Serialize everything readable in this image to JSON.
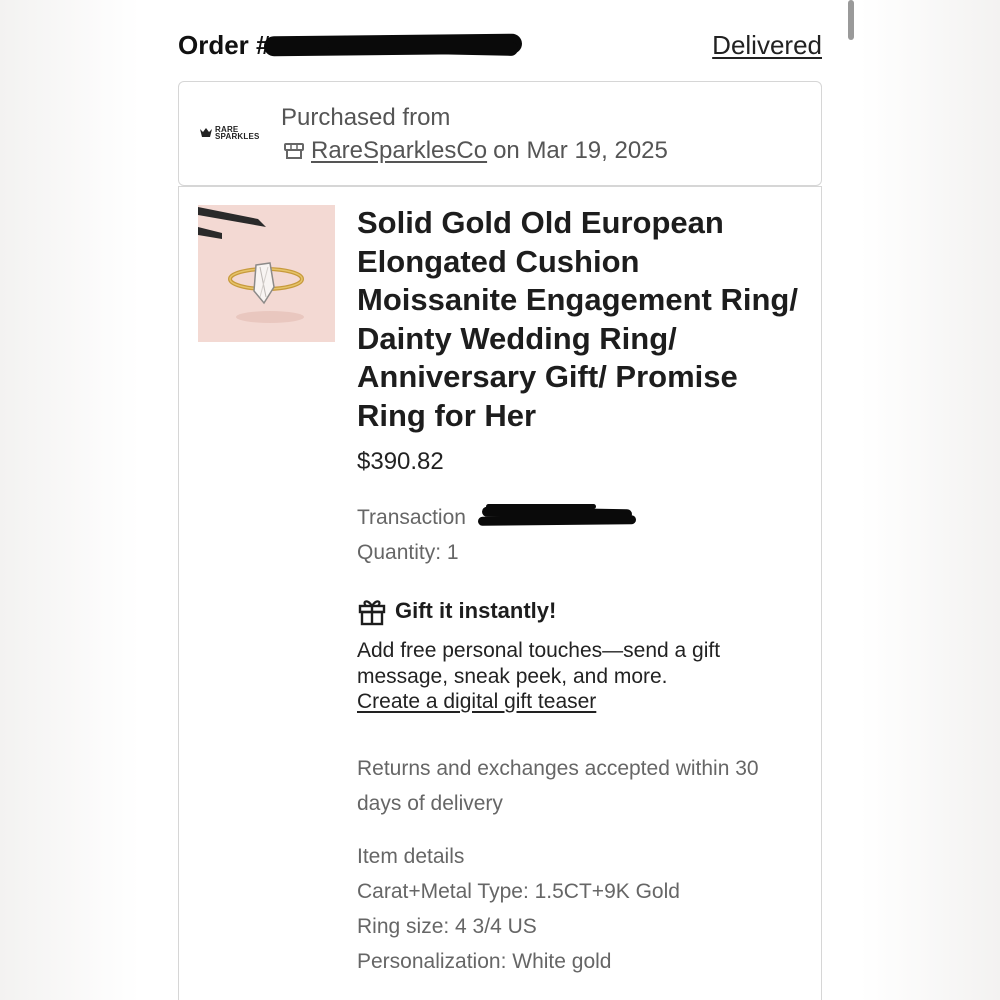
{
  "order": {
    "label": "Order #",
    "status": "Delivered"
  },
  "shop": {
    "logo_text_line1": "RARE",
    "logo_text_line2": "SPARKLES",
    "purchased_from": "Purchased from",
    "name": "RareSparklesCo",
    "date_text": "on Mar 19, 2025"
  },
  "item": {
    "title": "Solid Gold Old European Elongated Cushion Moissanite Engagement Ring/ Dainty Wedding Ring/ Anniversary Gift/ Promise Ring for Her",
    "price": "$390.82",
    "transaction_label": "Transaction",
    "quantity": "Quantity: 1"
  },
  "gift": {
    "title": "Gift it instantly!",
    "description": "Add free personal touches—send a gift message, sneak peek, and more.",
    "link": "Create a digital gift teaser"
  },
  "returns": {
    "text": "Returns and exchanges accepted within 30 days of delivery"
  },
  "details": {
    "heading": "Item details",
    "rows": [
      "Carat+Metal Type: 1.5CT+9K Gold",
      "Ring size: 4 3/4 US",
      "Personalization: White gold"
    ]
  }
}
